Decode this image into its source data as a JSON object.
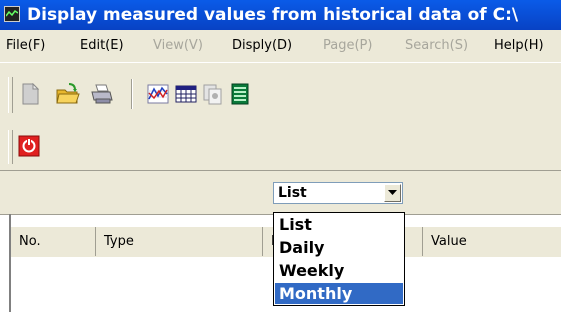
{
  "window": {
    "title": "Display measured values from historical data of C:\\"
  },
  "menu": [
    {
      "label": "File(F)",
      "enabled": true
    },
    {
      "label": "Edit(E)",
      "enabled": true
    },
    {
      "label": "View(V)",
      "enabled": false
    },
    {
      "label": "Disply(D)",
      "enabled": true
    },
    {
      "label": "Page(P)",
      "enabled": false
    },
    {
      "label": "Search(S)",
      "enabled": false
    },
    {
      "label": "Help(H)",
      "enabled": true
    }
  ],
  "toolbar": {
    "buttons": [
      "new-file-icon",
      "open-folder-icon",
      "print-icon",
      "chart-icon",
      "calendar-table-icon",
      "copy-report-icon",
      "list-view-icon"
    ],
    "stop_button_icon": "power-stop-icon"
  },
  "view_select": {
    "value": "List",
    "options": [
      "List",
      "Daily",
      "Weekly",
      "Monthly"
    ],
    "highlighted": "Monthly"
  },
  "table": {
    "columns": [
      "No.",
      "Type",
      "N",
      "Value"
    ]
  },
  "colors": {
    "titlebar": "#0a5be8",
    "selection": "#316ac5",
    "stop_button": "#e02020"
  }
}
